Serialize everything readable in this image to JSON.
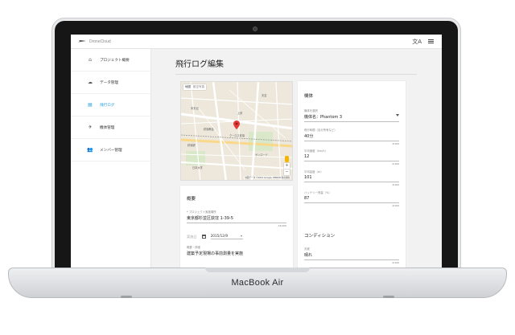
{
  "device": {
    "label": "MacBook Air"
  },
  "appbar": {
    "app_name": "DroneCloud",
    "translate_glyph": "文A",
    "icons": [
      "drone-logo-icon",
      "translate-icon",
      "menu-icon"
    ]
  },
  "sidebar": {
    "items": [
      {
        "label": "プロジェクト概要",
        "icon": "home-icon",
        "glyph": "⌂",
        "active": false
      },
      {
        "label": "データ管理",
        "icon": "cloud-icon",
        "glyph": "☁",
        "active": false
      },
      {
        "label": "飛行ログ",
        "icon": "log-icon",
        "glyph": "▤",
        "active": true
      },
      {
        "label": "機体管理",
        "icon": "airplane-icon",
        "glyph": "✈",
        "active": false
      },
      {
        "label": "メンバー管理",
        "icon": "people-icon",
        "glyph": "👥",
        "active": false
      }
    ],
    "accent_color": "#1e9bd7"
  },
  "page": {
    "title": "飛行ログ編集"
  },
  "map": {
    "toggle": [
      "地図",
      "航空写真"
    ],
    "zoom_in": "+",
    "zoom_out": "−",
    "footer": "地図データ ©2015 Google, ZENRIN  利用規約",
    "labels": [
      "クーロス荻窪",
      "荻窪教会",
      "荻窪駅",
      "サンロード",
      "天沼",
      "本天沼",
      "上荻",
      "日本大学"
    ]
  },
  "summary": {
    "title": "概要",
    "location_label": "* プロジェクト実施場所",
    "location_value": "東京都杉並区荻窪 1-39-5",
    "location_count": "14/100",
    "date_placeholder": "実施日",
    "date_value": "2015/12/9",
    "purpose_label": "概要・詳細",
    "purpose_value": "建築予定現場の事前測量を実施"
  },
  "aircraft": {
    "title": "機体",
    "select_label": "機体を選択",
    "select_value": "機体名：Phantom 3",
    "flight_time_label": "飛行時間（自分所有など）",
    "flight_time_value": "40分",
    "flight_time_count": "3/100",
    "speed_label": "平均速度（km/h）",
    "speed_value": "12",
    "speed_count": "2/100",
    "altitude_label": "平均高度（m）",
    "altitude_value": "101",
    "altitude_count": "3/100",
    "battery_label": "バッテリー残量（%）",
    "battery_value": "87",
    "battery_count": "2/100"
  },
  "condition": {
    "title": "コンディション",
    "weather_label": "天候",
    "weather_value": "晴れ",
    "weather_count": "2/100"
  }
}
